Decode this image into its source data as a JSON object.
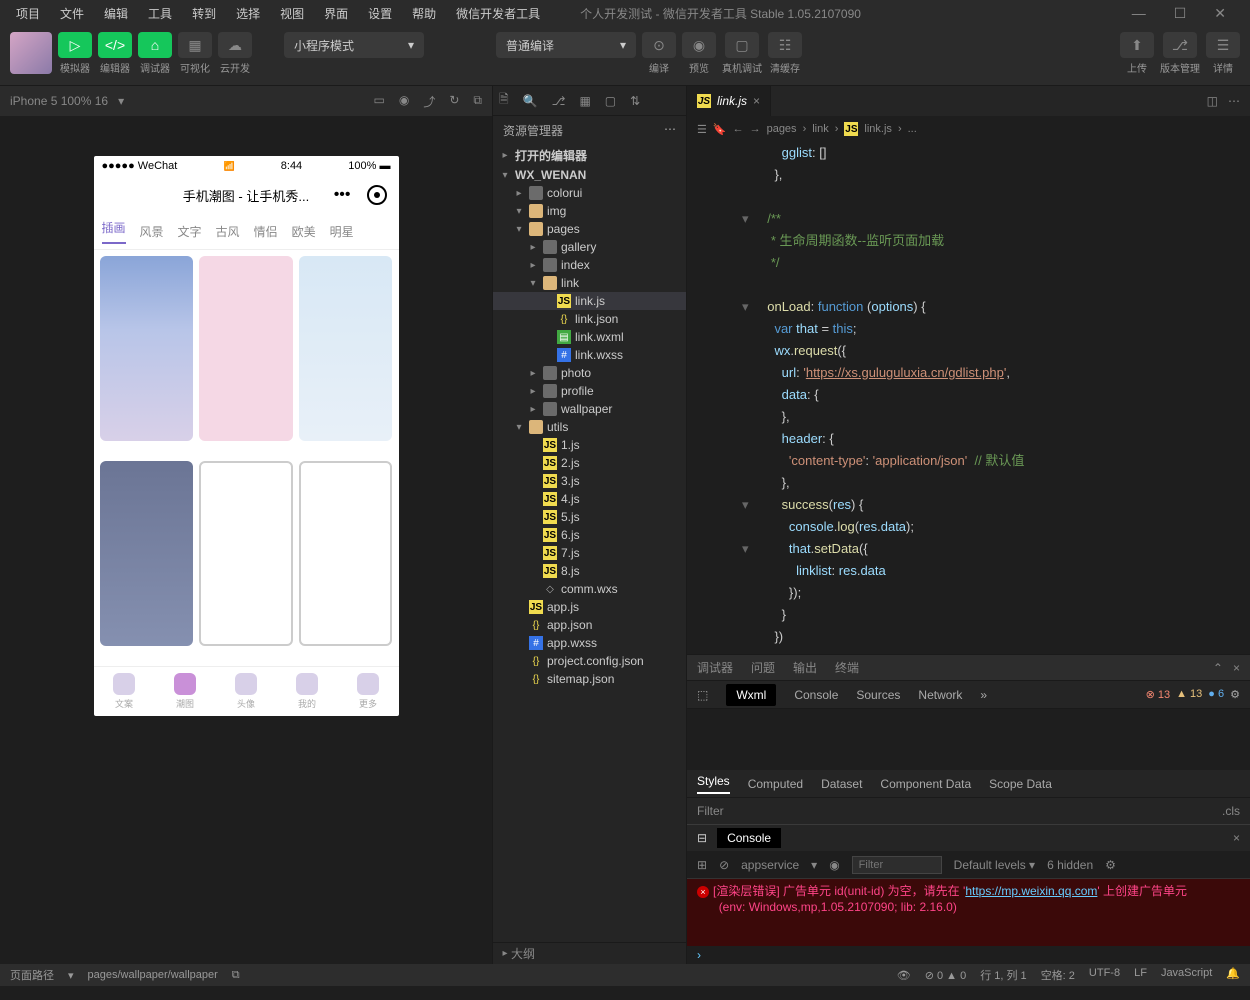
{
  "menu": [
    "项目",
    "文件",
    "编辑",
    "工具",
    "转到",
    "选择",
    "视图",
    "界面",
    "设置",
    "帮助",
    "微信开发者工具"
  ],
  "title": "个人开发测试 - 微信开发者工具 Stable 1.05.2107090",
  "toolbar": {
    "buttons": [
      "模拟器",
      "编辑器",
      "调试器"
    ],
    "vis": "可视化",
    "cloud": "云开发",
    "mode": "小程序模式",
    "compile": "普通编译",
    "actions": [
      "编译",
      "预览",
      "真机调试",
      "清缓存"
    ],
    "right": [
      "上传",
      "版本管理",
      "详情"
    ]
  },
  "sim": {
    "device": "iPhone 5 100% 16",
    "status_l": "●●●●● WeChat",
    "status_time": "8:44",
    "status_r": "100%",
    "app_title": "手机潮图 - 让手机秀...",
    "tabs": [
      "插画",
      "风景",
      "文字",
      "古风",
      "情侣",
      "欧美",
      "明星"
    ],
    "nav": [
      "文案",
      "潮图",
      "头像",
      "我的",
      "更多"
    ]
  },
  "explorer": {
    "title": "资源管理器",
    "sections": [
      "打开的编辑器",
      "WX_WENAN"
    ],
    "tree": [
      {
        "d": 1,
        "t": "folder",
        "n": "colorui"
      },
      {
        "d": 1,
        "t": "folder",
        "n": "img",
        "open": true
      },
      {
        "d": 1,
        "t": "folder",
        "n": "pages",
        "open": true
      },
      {
        "d": 2,
        "t": "folder",
        "n": "gallery"
      },
      {
        "d": 2,
        "t": "folder",
        "n": "index"
      },
      {
        "d": 2,
        "t": "folder",
        "n": "link",
        "open": true
      },
      {
        "d": 3,
        "t": "js",
        "n": "link.js",
        "sel": true
      },
      {
        "d": 3,
        "t": "json",
        "n": "link.json"
      },
      {
        "d": 3,
        "t": "wxml",
        "n": "link.wxml"
      },
      {
        "d": 3,
        "t": "wxss",
        "n": "link.wxss"
      },
      {
        "d": 2,
        "t": "folder",
        "n": "photo"
      },
      {
        "d": 2,
        "t": "folder",
        "n": "profile"
      },
      {
        "d": 2,
        "t": "folder",
        "n": "wallpaper"
      },
      {
        "d": 1,
        "t": "folder",
        "n": "utils",
        "open": true
      },
      {
        "d": 2,
        "t": "js",
        "n": "1.js"
      },
      {
        "d": 2,
        "t": "js",
        "n": "2.js"
      },
      {
        "d": 2,
        "t": "js",
        "n": "3.js"
      },
      {
        "d": 2,
        "t": "js",
        "n": "4.js"
      },
      {
        "d": 2,
        "t": "js",
        "n": "5.js"
      },
      {
        "d": 2,
        "t": "js",
        "n": "6.js"
      },
      {
        "d": 2,
        "t": "js",
        "n": "7.js"
      },
      {
        "d": 2,
        "t": "js",
        "n": "8.js"
      },
      {
        "d": 2,
        "t": "wxs",
        "n": "comm.wxs"
      },
      {
        "d": 1,
        "t": "js",
        "n": "app.js"
      },
      {
        "d": 1,
        "t": "json",
        "n": "app.json"
      },
      {
        "d": 1,
        "t": "wxss",
        "n": "app.wxss"
      },
      {
        "d": 1,
        "t": "json",
        "n": "project.config.json"
      },
      {
        "d": 1,
        "t": "json",
        "n": "sitemap.json"
      }
    ],
    "outline": "大纲"
  },
  "editor": {
    "tab": "link.js",
    "crumb": [
      "pages",
      "link",
      "link.js",
      "..."
    ],
    "code": [
      "      gglist: []",
      "    },",
      "",
      "  /**",
      "   * 生命周期函数--监听页面加载",
      "   */",
      "",
      "  onLoad: function (options) {",
      "    var that = this;",
      "    wx.request({",
      "      url: 'https://xs.guluguluxia.cn/gdlist.php',",
      "      data: {",
      "      },",
      "      header: {",
      "        'content-type': 'application/json'  // 默认值",
      "      },",
      "      success(res) {",
      "        console.log(res.data);",
      "        that.setData({",
      "          linklist: res.data",
      "        });",
      "      }",
      "    })"
    ]
  },
  "devtools": {
    "head": [
      "调试器",
      "问题",
      "输出",
      "终端"
    ],
    "tabs": [
      "Wxml",
      "Console",
      "Sources",
      "Network"
    ],
    "badges": {
      "err": "13",
      "warn": "13",
      "info": "6"
    },
    "sub": [
      "Styles",
      "Computed",
      "Dataset",
      "Component Data",
      "Scope Data"
    ],
    "filter": "Filter",
    "cls": ".cls"
  },
  "console": {
    "tab": "Console",
    "ctx": "appservice",
    "filter_ph": "Filter",
    "levels": "Default levels",
    "hidden": "6 hidden",
    "err1": "[渲染层错误] 广告单元 id(unit-id) 为空，请先在 '",
    "err_url": "https://mp.weixin.qq.com",
    "err2": "' 上创建广告单元",
    "env": "(env: Windows,mp,1.05.2107090; lib: 2.16.0)"
  },
  "status": {
    "path_label": "页面路径",
    "path": "pages/wallpaper/wallpaper",
    "warn": "0",
    "err": "0",
    "pos": "行 1, 列 1",
    "spaces": "空格: 2",
    "enc": "UTF-8",
    "eol": "LF",
    "lang": "JavaScript"
  }
}
